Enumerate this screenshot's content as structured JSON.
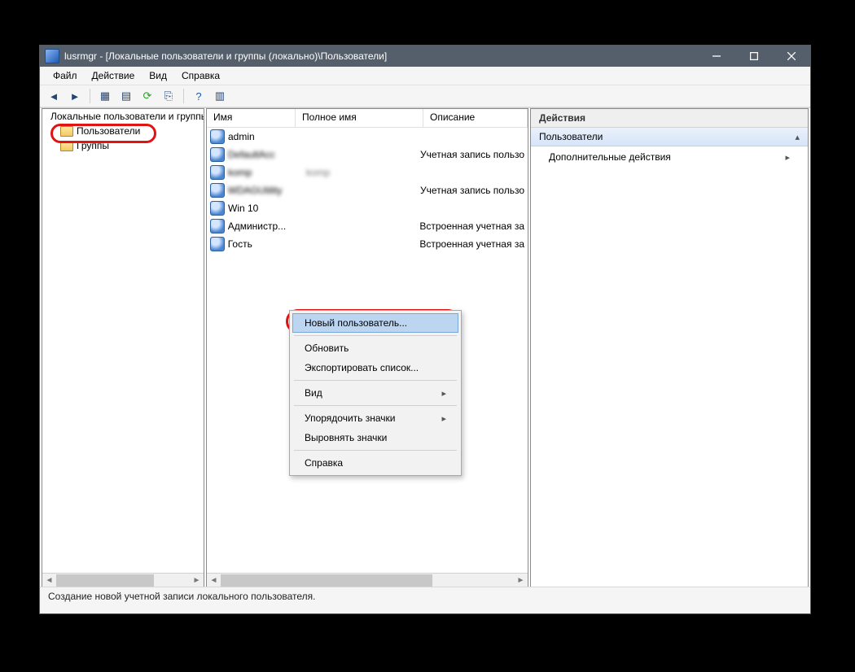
{
  "window": {
    "title": "lusrmgr - [Локальные пользователи и группы (локально)\\Пользователи]"
  },
  "menu": {
    "file": "Файл",
    "action": "Действие",
    "view": "Вид",
    "help": "Справка"
  },
  "tree": {
    "root": "Локальные пользователи и группы",
    "users": "Пользователи",
    "groups": "Группы"
  },
  "list": {
    "columns": {
      "name": "Имя",
      "fullname": "Полное имя",
      "desc": "Описание"
    },
    "rows": [
      {
        "name": "admin",
        "fullname": "",
        "desc": ""
      },
      {
        "name": "DefaultAcc",
        "fullname": "",
        "desc": "Учетная запись пользо"
      },
      {
        "name": "komp",
        "fullname": "komp",
        "desc": ""
      },
      {
        "name": "WDAGUtility",
        "fullname": "",
        "desc": "Учетная запись пользо"
      },
      {
        "name": "Win 10",
        "fullname": "",
        "desc": ""
      },
      {
        "name": "Администр...",
        "fullname": "",
        "desc": "Встроенная учетная за"
      },
      {
        "name": "Гость",
        "fullname": "",
        "desc": "Встроенная учетная за"
      }
    ]
  },
  "actions": {
    "header": "Действия",
    "section": "Пользователи",
    "more": "Дополнительные действия"
  },
  "context": {
    "newUser": "Новый пользователь...",
    "refresh": "Обновить",
    "export": "Экспортировать список...",
    "view": "Вид",
    "arrange": "Упорядочить значки",
    "align": "Выровнять значки",
    "help": "Справка"
  },
  "status": {
    "text": "Создание новой учетной записи локального пользователя."
  }
}
